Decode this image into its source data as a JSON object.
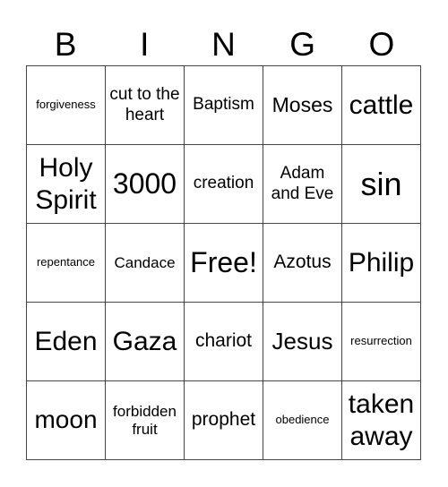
{
  "card": {
    "header": [
      "B",
      "I",
      "N",
      "G",
      "O"
    ],
    "rows": [
      [
        "forgiveness",
        "cut to the heart",
        "Baptism",
        "Moses",
        "cattle"
      ],
      [
        "Holy Spirit",
        "3000",
        "creation",
        "Adam and Eve",
        "sin"
      ],
      [
        "repentance",
        "Candace",
        "Free!",
        "Azotus",
        "Philip"
      ],
      [
        "Eden",
        "Gaza",
        "chariot",
        "Jesus",
        "resurrection"
      ],
      [
        "moon",
        "forbidden fruit",
        "prophet",
        "obedience",
        "taken away"
      ]
    ],
    "free_space": "Free!"
  }
}
